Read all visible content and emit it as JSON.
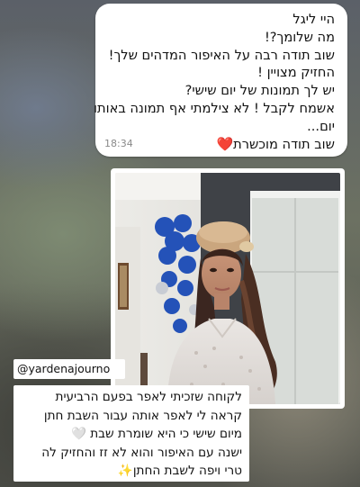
{
  "message": {
    "lines": [
      "היי ליגל",
      "מה שלומך?!",
      "שוב תודה רבה על האיפור המדהים שלך!",
      "החזיק מצויין !",
      "יש לך תמונות של יום שישי?",
      "אשמח לקבל ! לא צילמתי אף תמונה באותו",
      "יום..."
    ],
    "last_line": "שוב תודה מוכשרת",
    "heart_emoji": "❤️",
    "time": "18:34"
  },
  "story": {
    "handle": "@yardenajourno",
    "caption_lines": [
      "לקוחה שזכיתי לאפר בפעם הרביעית",
      "קראה לי לאפר אותה עבור השבת חתן",
      "מיום שישי כי היא שומרת שבת 🤍",
      "ישנה עם האיפור והוא לא זז והחזיק לה",
      "טרי ויפה לשבת החתן✨"
    ]
  }
}
